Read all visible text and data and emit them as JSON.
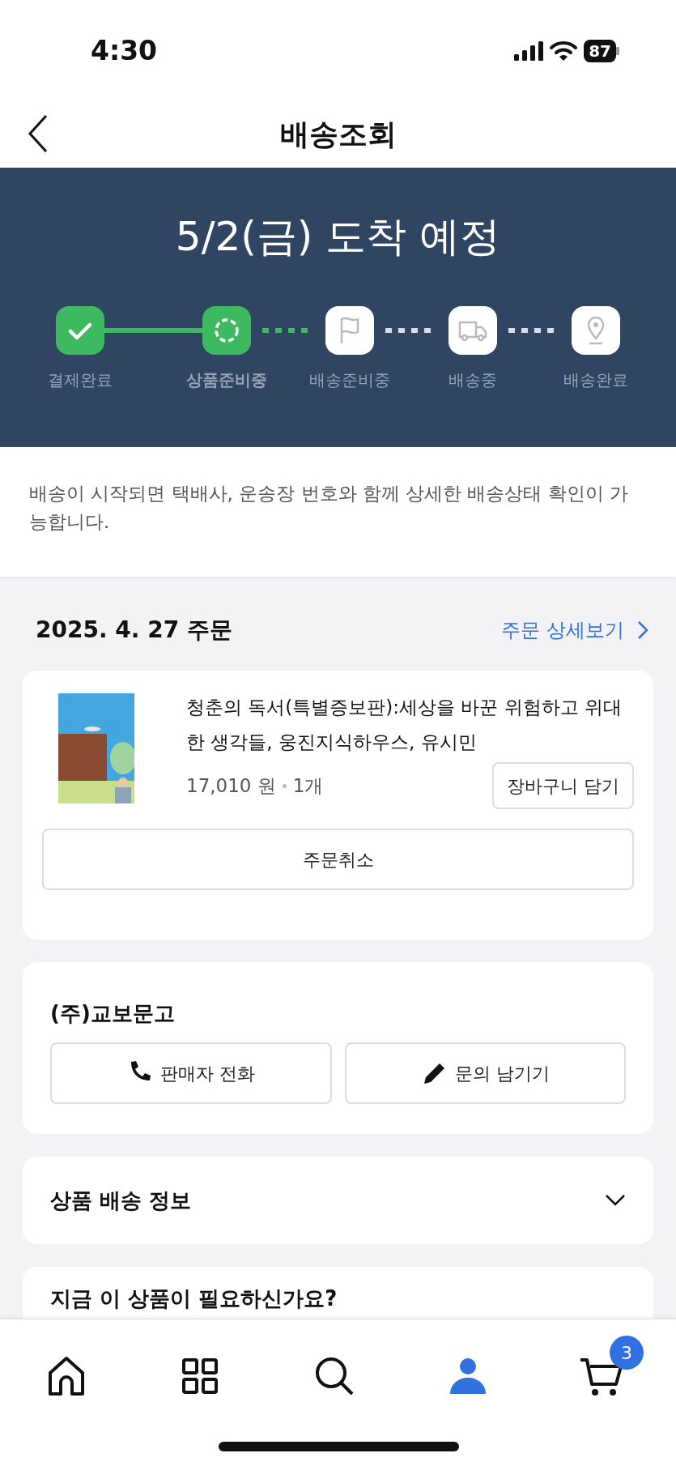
{
  "status_bar": {
    "time": "4:30",
    "battery": "87"
  },
  "header": {
    "title": "배송조회"
  },
  "banner": {
    "title": "5/2(금) 도착 예정",
    "steps": [
      {
        "label": "결제완료",
        "kind": "done"
      },
      {
        "label": "상품준비중",
        "kind": "current"
      },
      {
        "label": "배송준비중",
        "kind": "pending"
      },
      {
        "label": "배송중",
        "kind": "pending"
      },
      {
        "label": "배송완료",
        "kind": "pending"
      }
    ]
  },
  "notice": "배송이 시작되면 택배사, 운송장 번호와 함께 상세한 배송상태 확인이 가능합니다.",
  "order": {
    "date": "2025. 4. 27 주문",
    "detail_link": "주문 상세보기",
    "item": {
      "title": "청춘의 독서(특별증보판):세상을 바꾼 위험하고 위대한 생각들, 웅진지식하우스, 유시민",
      "price": "17,010 원",
      "quantity": "1개",
      "cart_button": "장바구니 담기"
    },
    "cancel_button": "주문취소"
  },
  "seller": {
    "name": "(주)교보문고",
    "buttons": [
      {
        "label": "판매자 전화"
      },
      {
        "label": "문의 남기기"
      }
    ]
  },
  "shipping_info": {
    "title": "상품 배송 정보",
    "expanded": false
  },
  "recommend": {
    "title": "지금 이 상품이 필요하신가요?"
  },
  "tab_bar": {
    "items": [
      {
        "selected": false
      },
      {
        "selected": false
      },
      {
        "selected": false
      },
      {
        "selected": true
      },
      {
        "selected": false,
        "badge": "3"
      }
    ]
  }
}
